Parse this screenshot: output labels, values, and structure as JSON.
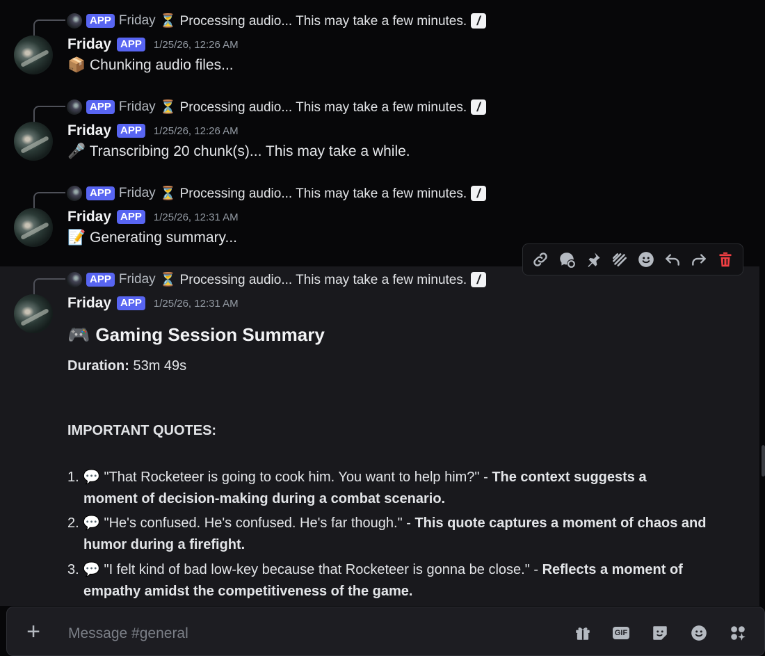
{
  "messages": [
    {
      "reply": {
        "app_badge": "APP",
        "author": "Friday",
        "text": "⏳ Processing audio... This may take a few minutes.",
        "slash": "/"
      },
      "author": "Friday",
      "app_badge": "APP",
      "timestamp": "1/25/26, 12:26 AM",
      "content": "📦 Chunking audio files..."
    },
    {
      "reply": {
        "app_badge": "APP",
        "author": "Friday",
        "text": "⏳ Processing audio... This may take a few minutes.",
        "slash": "/"
      },
      "author": "Friday",
      "app_badge": "APP",
      "timestamp": "1/25/26, 12:26 AM",
      "content": "🎤 Transcribing 20 chunk(s)... This may take a while."
    },
    {
      "reply": {
        "app_badge": "APP",
        "author": "Friday",
        "text": "⏳ Processing audio... This may take a few minutes.",
        "slash": "/"
      },
      "author": "Friday",
      "app_badge": "APP",
      "timestamp": "1/25/26, 12:31 AM",
      "content": "📝 Generating summary..."
    },
    {
      "reply": {
        "app_badge": "APP",
        "author": "Friday",
        "text": "⏳ Processing audio... This may take a few minutes.",
        "slash": "/"
      },
      "author": "Friday",
      "app_badge": "APP",
      "timestamp": "1/25/26, 12:31 AM",
      "summary": {
        "heading_icon": "🎮",
        "heading": "Gaming Session Summary",
        "duration_label": "Duration:",
        "duration_value": "53m 49s",
        "quotes_heading": "IMPORTANT QUOTES:",
        "quotes": [
          {
            "num": "1.",
            "icon": "💬",
            "quote": "\"That Rocketeer is going to cook him. You want to help him?\" - ",
            "bold_line1": "The context suggests a",
            "bold_line2": "moment of decision-making during a combat scenario."
          },
          {
            "num": "2.",
            "icon": "💬",
            "quote": "\"He's confused. He's confused. He's far though.\" - ",
            "bold_line1": "This quote captures a moment of chaos and",
            "bold_line2": "humor during a firefight."
          },
          {
            "num": "3.",
            "icon": "💬",
            "quote": "\"I felt kind of bad low-key because that Rocketeer is gonna be close.\" - ",
            "bold_line1": "Reflects a moment of",
            "bold_line2": "empathy amidst the competitiveness of the game."
          }
        ]
      }
    }
  ],
  "toolbar_icons": [
    "link-icon",
    "thread-icon",
    "pin-icon",
    "super-reaction-icon",
    "emoji-icon",
    "reply-icon",
    "forward-icon",
    "delete-icon"
  ],
  "composer": {
    "placeholder": "Message #general",
    "icons": [
      "gift-icon",
      "gif-icon",
      "sticker-icon",
      "emoji-icon",
      "apps-icon"
    ],
    "gif_label": "GIF"
  },
  "colors": {
    "accent": "#5865f2",
    "danger": "#f23f43",
    "background": "#070709",
    "hover": "#19191d"
  }
}
